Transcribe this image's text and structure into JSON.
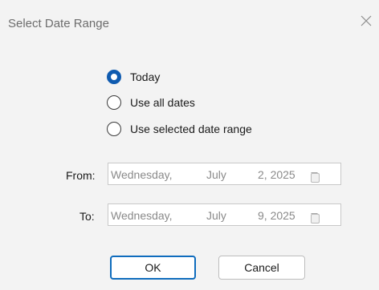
{
  "dialog": {
    "title": "Select Date Range",
    "close_icon": "close-icon"
  },
  "range_options": [
    {
      "label": "Today",
      "selected": true
    },
    {
      "label": "Use all dates",
      "selected": false
    },
    {
      "label": "Use selected date range",
      "selected": false
    }
  ],
  "from": {
    "label": "From:",
    "weekday": "Wednesday,",
    "month": "July",
    "day_year": "2, 2025",
    "icon": "calendar-icon"
  },
  "to": {
    "label": "To:",
    "weekday": "Wednesday,",
    "month": "July",
    "day_year": "9, 2025",
    "icon": "calendar-icon"
  },
  "buttons": {
    "ok_label": "OK",
    "cancel_label": "Cancel"
  },
  "colors": {
    "accent": "#0f5bb0",
    "ok_border": "#0f6cbd",
    "background": "#f3f3f3"
  }
}
